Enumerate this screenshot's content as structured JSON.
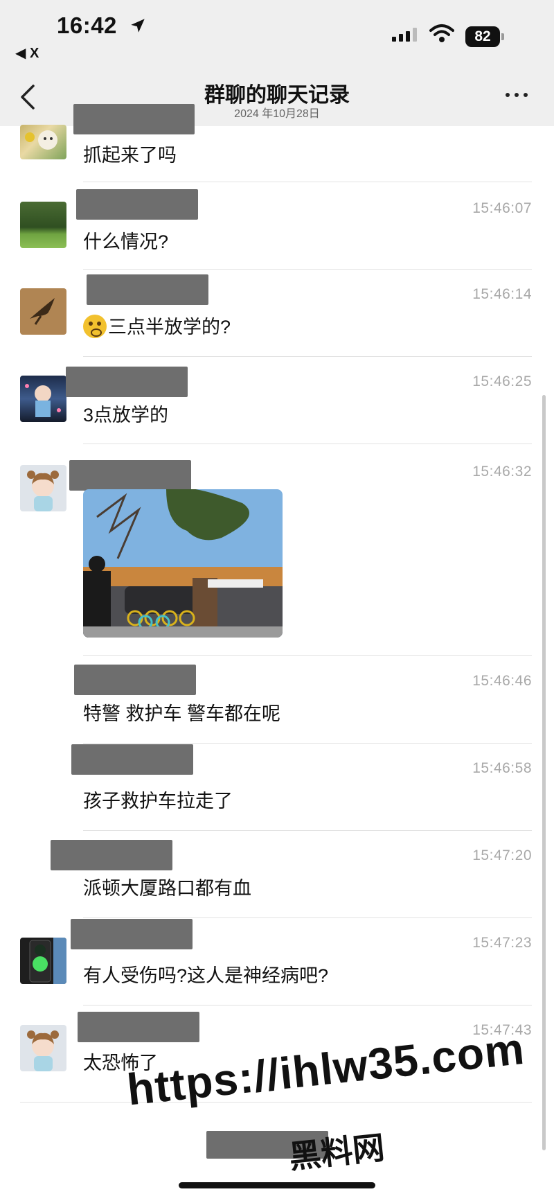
{
  "status_bar": {
    "time": "16:42",
    "back_app": "◀ X",
    "battery": "82"
  },
  "nav": {
    "title": "群聊的聊天记录",
    "subtitle": "2024 年10月28日"
  },
  "messages": [
    {
      "time": "",
      "text": "抓起来了吗"
    },
    {
      "time": "15:46:07",
      "text": "什么情况?"
    },
    {
      "time": "15:46:14",
      "text": "三点半放学的?"
    },
    {
      "time": "15:46:25",
      "text": "3点放学的"
    },
    {
      "time": "15:46:32",
      "text": ""
    },
    {
      "time": "15:46:46",
      "text": "特警 救护车 警车都在呢"
    },
    {
      "time": "15:46:58",
      "text": "孩子救护车拉走了"
    },
    {
      "time": "15:47:20",
      "text": "派顿大厦路口都有血"
    },
    {
      "time": "15:47:23",
      "text": "有人受伤吗?这人是神经病吧?"
    },
    {
      "time": "15:47:43",
      "text": "太恐怖了"
    }
  ],
  "watermark": {
    "url": "https://ihlw35.com",
    "site": "黑料网"
  },
  "colors": {
    "topbar": "#efefef",
    "redaction": "#6e6e6e",
    "timestamp": "#a8a8a8"
  }
}
